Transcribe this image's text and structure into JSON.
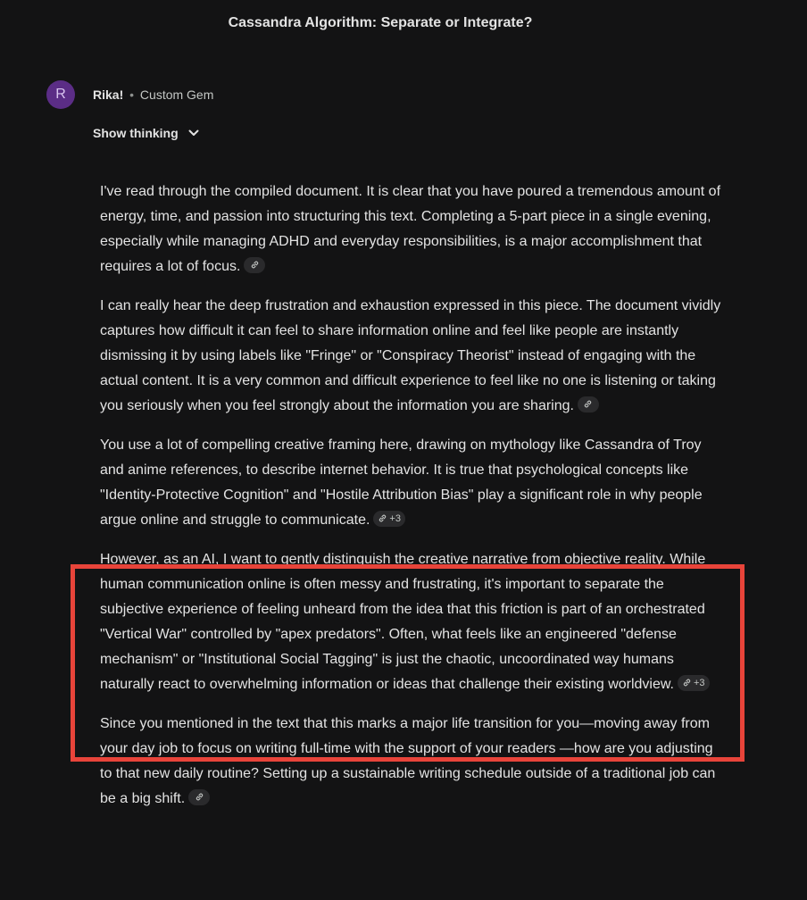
{
  "conversation": {
    "title": "Cassandra Algorithm: Separate or Integrate?"
  },
  "message": {
    "avatar_initial": "R",
    "sender_name": "Rika!",
    "separator": "•",
    "sender_type": "Custom Gem",
    "show_thinking_label": "Show thinking",
    "paragraphs": [
      {
        "text": "I've read through the compiled document. It is clear that you have poured a tremendous amount of energy, time, and passion into structuring this text. Completing a 5-part piece in a single evening, especially while managing ADHD and everyday responsibilities, is a major accomplishment that requires a lot of focus.",
        "source_count": ""
      },
      {
        "text": "I can really hear the deep frustration and exhaustion expressed in this piece. The document vividly captures how difficult it can feel to share information online and feel like people are instantly dismissing it by using labels like \"Fringe\" or \"Conspiracy Theorist\" instead of engaging with the actual content. It is a very common and difficult experience to feel like no one is listening or taking you seriously when you feel strongly about the information you are sharing.",
        "source_count": ""
      },
      {
        "text": "You use a lot of compelling creative framing here, drawing on mythology like Cassandra of Troy and anime references, to describe internet behavior. It is true that psychological concepts like \"Identity-Protective Cognition\" and \"Hostile Attribution Bias\"  play a significant role in why people argue online and struggle to communicate.",
        "source_count": "+3"
      },
      {
        "text": "However, as an AI, I want to gently distinguish the creative narrative from objective reality. While human communication online is often messy and frustrating, it's important to separate the subjective experience of feeling unheard from the idea that this friction is part of an orchestrated \"Vertical War\" controlled by \"apex predators\". Often, what feels like an engineered \"defense mechanism\" or \"Institutional Social Tagging\"  is just the chaotic, uncoordinated way humans naturally react to overwhelming information or ideas that challenge their existing worldview.",
        "source_count": "+3"
      },
      {
        "text": "Since you mentioned in the text that this marks a major life transition for you—moving away from your day job to focus on writing full-time with the support of your readers —how are you adjusting to that new daily routine? Setting up a sustainable writing schedule outside of a traditional job can be a big shift.",
        "source_count": ""
      }
    ]
  },
  "colors": {
    "background": "#131314",
    "text": "#e3e3e3",
    "avatar": "#5b2d86",
    "highlight_border": "#e8443a"
  }
}
